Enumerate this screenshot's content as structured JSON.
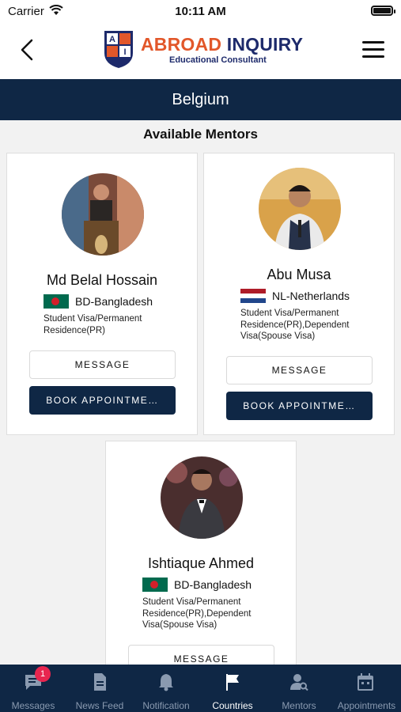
{
  "status_bar": {
    "carrier": "Carrier",
    "time": "10:11 AM"
  },
  "header": {
    "brand_part1": "ABROAD ",
    "brand_part2": "INQUIRY",
    "tagline": "Educational Consultant",
    "logo_letters": [
      "A",
      "I"
    ]
  },
  "page_title": "Belgium",
  "section_title": "Available Mentors",
  "mentors": [
    {
      "name": "Md Belal Hossain",
      "country": "BD-Bangladesh",
      "flag": "bangladesh",
      "services": "Student Visa/Permanent Residence(PR)",
      "message_label": "MESSAGE",
      "book_label": "BOOK APPOINTME…"
    },
    {
      "name": "Abu Musa",
      "country": "NL-Netherlands",
      "flag": "netherlands",
      "services": "Student Visa/Permanent Residence(PR),Dependent Visa(Spouse Visa)",
      "message_label": "MESSAGE",
      "book_label": "BOOK APPOINTME…"
    },
    {
      "name": "Ishtiaque Ahmed",
      "country": "BD-Bangladesh",
      "flag": "bangladesh",
      "services": "Student Visa/Permanent Residence(PR),Dependent Visa(Spouse Visa)",
      "message_label": "MESSAGE"
    }
  ],
  "tabs": [
    {
      "label": "Messages",
      "icon": "chat-icon",
      "badge": "1"
    },
    {
      "label": "News Feed",
      "icon": "document-icon"
    },
    {
      "label": "Notification",
      "icon": "bell-icon"
    },
    {
      "label": "Countries",
      "icon": "flag-icon",
      "active": true
    },
    {
      "label": "Mentors",
      "icon": "mentor-search-icon"
    },
    {
      "label": "Appointments",
      "icon": "calendar-icon"
    }
  ],
  "colors": {
    "navy": "#0f2745",
    "brand_orange": "#e2572a",
    "brand_blue": "#1d2a6b",
    "badge_red": "#e8254f"
  }
}
